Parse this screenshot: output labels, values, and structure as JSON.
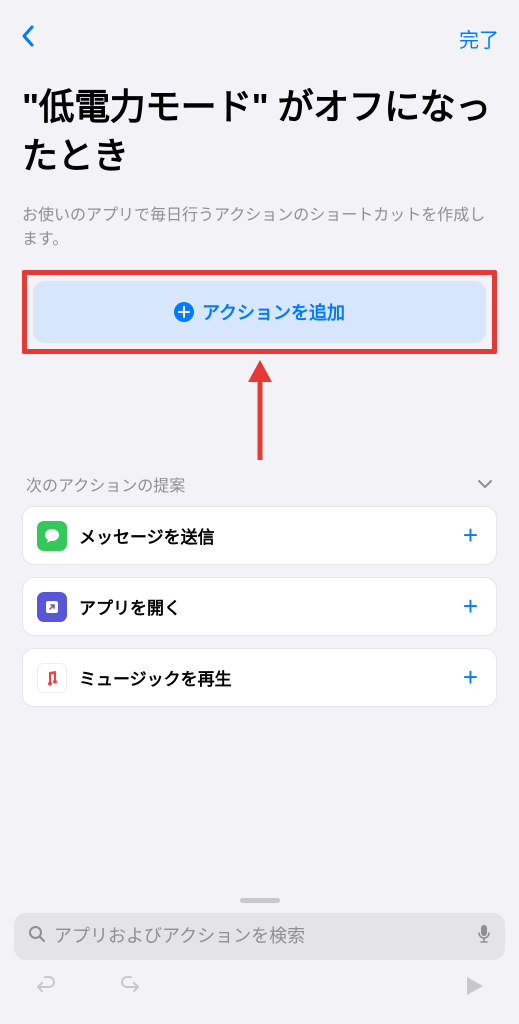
{
  "nav": {
    "done_label": "完了"
  },
  "header": {
    "title": "\"低電力モード\" がオフになったとき",
    "subtitle": "お使いのアプリで毎日行うアクションのショートカットを作成します。"
  },
  "add_action": {
    "label": "アクションを追加"
  },
  "suggestions": {
    "header_label": "次のアクションの提案",
    "items": [
      {
        "label": "メッセージを送信",
        "icon": "messages"
      },
      {
        "label": "アプリを開く",
        "icon": "shortcuts"
      },
      {
        "label": "ミュージックを再生",
        "icon": "music"
      }
    ]
  },
  "search": {
    "placeholder": "アプリおよびアクションを検索"
  }
}
